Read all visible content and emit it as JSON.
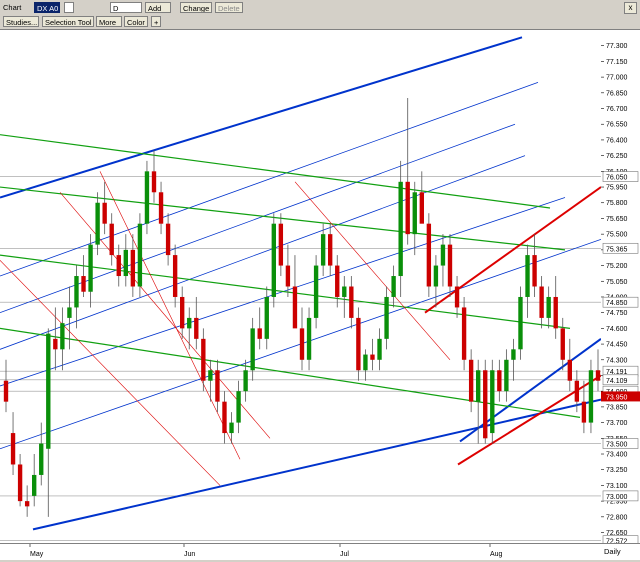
{
  "window": {
    "title": "Chart",
    "symbol": "DX A0",
    "interval": "D",
    "close_label": "x"
  },
  "toolbar": {
    "add_label": "Add",
    "change_label": "Change",
    "delete_label": "Delete",
    "studies_label": "Studies...",
    "selection_tool_label": "Selection Tool",
    "more_label": "More",
    "color_label": "Color",
    "plus_label": "+"
  },
  "axis": {
    "period_label": "Daily"
  },
  "colors": {
    "bull": "#0a8f0a",
    "bear": "#cc0000",
    "blue_channel": "#0033cc",
    "green_channel": "#11a011",
    "red_channel": "#dd0000"
  },
  "chart_data": {
    "type": "candlestick",
    "y_ticks": [
      "77.300",
      "77.150",
      "77.000",
      "76.850",
      "76.700",
      "76.550",
      "76.400",
      "76.250",
      "76.100",
      "75.950",
      "75.800",
      "75.650",
      "75.500",
      "75.350",
      "75.200",
      "75.050",
      "74.900",
      "74.750",
      "74.600",
      "74.450",
      "74.300",
      "74.150",
      "74.000",
      "73.850",
      "73.700",
      "73.550",
      "73.400",
      "73.250",
      "73.100",
      "72.950",
      "72.800",
      "72.650"
    ],
    "price_badges": [
      "76.050",
      "75.365",
      "74.850",
      "74.191",
      "74.109",
      "74.000",
      "73.500",
      "73.000",
      "72.572"
    ],
    "current_price_badge": "73.950",
    "x_labels": [
      "May",
      "Jun",
      "Jul",
      "Aug"
    ],
    "ylim": [
      72.55,
      77.45
    ],
    "candles": [
      [
        74.1,
        74.3,
        73.8,
        73.9
      ],
      [
        73.6,
        73.8,
        73.2,
        73.3
      ],
      [
        73.3,
        73.4,
        72.9,
        72.95
      ],
      [
        72.95,
        73.1,
        72.8,
        72.9
      ],
      [
        73.0,
        73.4,
        72.9,
        73.2
      ],
      [
        73.2,
        73.7,
        73.1,
        73.5
      ],
      [
        73.45,
        74.6,
        72.8,
        74.55
      ],
      [
        74.5,
        74.8,
        74.2,
        74.4
      ],
      [
        74.4,
        74.8,
        74.2,
        74.65
      ],
      [
        74.7,
        75.0,
        74.4,
        74.8
      ],
      [
        74.8,
        75.2,
        74.6,
        75.1
      ],
      [
        75.1,
        75.3,
        74.9,
        74.95
      ],
      [
        74.95,
        75.5,
        74.8,
        75.4
      ],
      [
        75.4,
        75.9,
        75.3,
        75.8
      ],
      [
        75.8,
        76.0,
        75.5,
        75.6
      ],
      [
        75.6,
        75.7,
        75.2,
        75.3
      ],
      [
        75.3,
        75.4,
        75.0,
        75.1
      ],
      [
        75.1,
        75.5,
        75.0,
        75.35
      ],
      [
        75.35,
        75.5,
        74.9,
        75.0
      ],
      [
        75.0,
        75.7,
        74.9,
        75.6
      ],
      [
        75.6,
        76.2,
        75.5,
        76.1
      ],
      [
        76.1,
        76.3,
        75.8,
        75.9
      ],
      [
        75.9,
        76.0,
        75.5,
        75.6
      ],
      [
        75.6,
        75.7,
        75.2,
        75.3
      ],
      [
        75.3,
        75.4,
        74.8,
        74.9
      ],
      [
        74.9,
        75.0,
        74.5,
        74.6
      ],
      [
        74.6,
        74.8,
        74.4,
        74.7
      ],
      [
        74.7,
        74.9,
        74.4,
        74.5
      ],
      [
        74.5,
        74.6,
        74.0,
        74.1
      ],
      [
        74.1,
        74.3,
        73.9,
        74.2
      ],
      [
        74.2,
        74.3,
        73.8,
        73.9
      ],
      [
        73.9,
        74.0,
        73.5,
        73.6
      ],
      [
        73.6,
        73.8,
        73.5,
        73.7
      ],
      [
        73.7,
        74.1,
        73.6,
        74.0
      ],
      [
        74.0,
        74.3,
        73.9,
        74.2
      ],
      [
        74.2,
        74.7,
        74.1,
        74.6
      ],
      [
        74.6,
        74.8,
        74.4,
        74.5
      ],
      [
        74.5,
        75.0,
        74.4,
        74.9
      ],
      [
        74.9,
        75.7,
        74.8,
        75.6
      ],
      [
        75.6,
        75.7,
        75.1,
        75.2
      ],
      [
        75.2,
        75.4,
        74.9,
        75.0
      ],
      [
        75.0,
        75.3,
        74.8,
        74.6
      ],
      [
        74.6,
        74.8,
        74.2,
        74.3
      ],
      [
        74.3,
        74.8,
        74.2,
        74.7
      ],
      [
        74.7,
        75.3,
        74.6,
        75.2
      ],
      [
        75.2,
        75.6,
        75.1,
        75.5
      ],
      [
        75.5,
        75.6,
        75.1,
        75.2
      ],
      [
        75.2,
        75.3,
        74.8,
        74.9
      ],
      [
        74.9,
        75.1,
        74.7,
        75.0
      ],
      [
        75.0,
        75.1,
        74.6,
        74.7
      ],
      [
        74.7,
        74.8,
        74.1,
        74.2
      ],
      [
        74.2,
        74.4,
        74.1,
        74.35
      ],
      [
        74.35,
        74.5,
        74.2,
        74.3
      ],
      [
        74.3,
        74.6,
        74.2,
        74.5
      ],
      [
        74.5,
        75.0,
        74.4,
        74.9
      ],
      [
        74.9,
        75.2,
        74.8,
        75.1
      ],
      [
        75.1,
        76.2,
        74.9,
        76.0
      ],
      [
        76.0,
        76.8,
        75.4,
        75.5
      ],
      [
        75.5,
        76.0,
        75.3,
        75.9
      ],
      [
        75.9,
        76.1,
        75.7,
        75.6
      ],
      [
        75.6,
        75.7,
        74.9,
        75.0
      ],
      [
        75.0,
        75.3,
        74.8,
        75.2
      ],
      [
        75.2,
        75.5,
        75.0,
        75.4
      ],
      [
        75.4,
        75.5,
        74.9,
        75.0
      ],
      [
        75.0,
        75.1,
        74.7,
        74.8
      ],
      [
        74.8,
        74.9,
        74.2,
        74.3
      ],
      [
        74.3,
        74.4,
        73.8,
        73.9
      ],
      [
        73.9,
        74.3,
        73.5,
        74.2
      ],
      [
        74.2,
        74.3,
        73.5,
        73.55
      ],
      [
        73.6,
        74.3,
        73.5,
        74.2
      ],
      [
        74.2,
        74.3,
        73.9,
        74.0
      ],
      [
        74.0,
        74.4,
        73.9,
        74.3
      ],
      [
        74.3,
        74.5,
        74.1,
        74.4
      ],
      [
        74.4,
        75.0,
        74.3,
        74.9
      ],
      [
        74.9,
        75.4,
        74.7,
        75.3
      ],
      [
        75.3,
        75.5,
        74.9,
        75.0
      ],
      [
        75.0,
        75.1,
        74.6,
        74.7
      ],
      [
        74.7,
        75.0,
        74.6,
        74.9
      ],
      [
        74.9,
        75.1,
        74.5,
        74.6
      ],
      [
        74.6,
        74.7,
        74.2,
        74.3
      ],
      [
        74.3,
        74.5,
        74.0,
        74.1
      ],
      [
        74.1,
        74.2,
        73.8,
        73.9
      ],
      [
        73.9,
        74.1,
        73.6,
        73.7
      ],
      [
        73.7,
        74.3,
        73.6,
        74.2
      ],
      [
        74.2,
        74.4,
        74.0,
        74.1
      ]
    ],
    "grid": false,
    "legend": "none"
  }
}
